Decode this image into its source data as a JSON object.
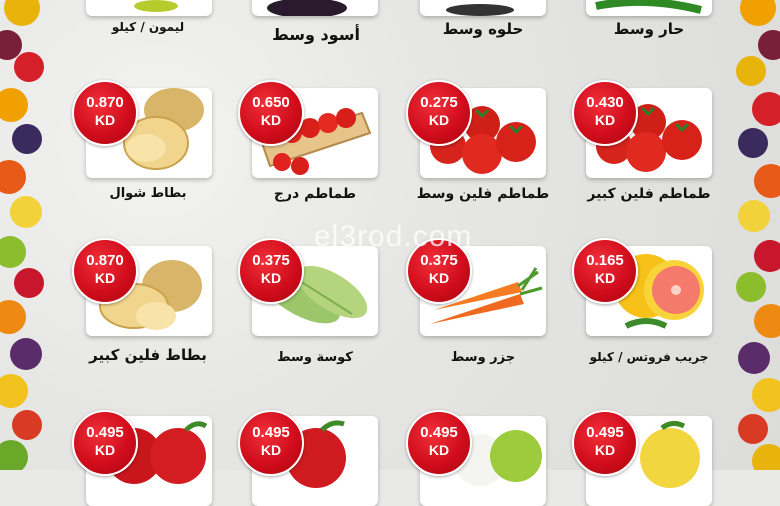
{
  "watermark": "el3rod.com",
  "top_row": [
    {
      "label": "ليمون / كيلو"
    },
    {
      "label": "أسود وسط"
    },
    {
      "label": "حلوه وسط"
    },
    {
      "label": "حار وسط"
    }
  ],
  "row2": [
    {
      "price": "0.870",
      "currency": "KD",
      "label": "بطاط شوال",
      "icon": "potato-icon"
    },
    {
      "price": "0.650",
      "currency": "KD",
      "label": "طماطم درج",
      "icon": "tomato-crate-icon"
    },
    {
      "price": "0.275",
      "currency": "KD",
      "label": "طماطم فلين وسط",
      "icon": "tomato-icon"
    },
    {
      "price": "0.430",
      "currency": "KD",
      "label": "طماطم فلين كبير",
      "icon": "tomato-icon"
    }
  ],
  "row3": [
    {
      "price": "0.870",
      "currency": "KD",
      "label": "بطاط فلين كبير",
      "icon": "potato-icon"
    },
    {
      "price": "0.375",
      "currency": "KD",
      "label": "كوسة وسط",
      "icon": "zucchini-icon"
    },
    {
      "price": "0.375",
      "currency": "KD",
      "label": "جزر وسط",
      "icon": "carrot-icon"
    },
    {
      "price": "0.165",
      "currency": "KD",
      "label": "جريب فروتس / كيلو",
      "icon": "grapefruit-icon"
    }
  ],
  "row4": [
    {
      "price": "0.495",
      "currency": "KD",
      "icon": "red-apple-icon"
    },
    {
      "price": "0.495",
      "currency": "KD",
      "icon": "red-apple-icon"
    },
    {
      "price": "0.495",
      "currency": "KD",
      "icon": "green-apple-icon"
    },
    {
      "price": "0.495",
      "currency": "KD",
      "icon": "yellow-apple-icon"
    }
  ],
  "colors": {
    "badge": "#d10d1c",
    "card": "#ffffff",
    "background": "#e9e9e8"
  }
}
